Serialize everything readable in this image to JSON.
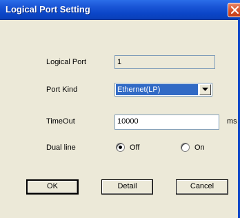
{
  "window": {
    "title": "Logical Port Setting",
    "title_bar_color": "#0A46C8",
    "close_icon": "close-icon"
  },
  "form": {
    "logical_port": {
      "label": "Logical Port",
      "value": "1"
    },
    "port_kind": {
      "label": "Port Kind",
      "selected": "Ethernet(LP)"
    },
    "timeout": {
      "label": "TimeOut",
      "value": "10000",
      "unit": "ms"
    },
    "dual_line": {
      "label": "Dual line",
      "options": [
        {
          "label": "Off",
          "selected": true
        },
        {
          "label": "On",
          "selected": false
        }
      ]
    }
  },
  "buttons": {
    "ok": "OK",
    "detail": "Detail",
    "cancel": "Cancel"
  }
}
